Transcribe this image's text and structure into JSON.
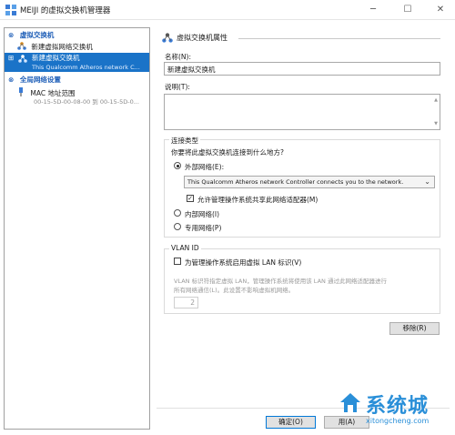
{
  "window": {
    "title": "MEIJI 的虚拟交换机管理器",
    "minimize": "─",
    "maximize": "☐",
    "close": "✕"
  },
  "tree": {
    "section1": {
      "toggle": "⊗",
      "label": "虚拟交换机"
    },
    "item_new_network_switch": "新建虚拟网络交换机",
    "item_selected": {
      "toggle": "⊞",
      "label": "新建虚拟交换机",
      "sublabel": "This Qualcomm Atheros network C..."
    },
    "section2": {
      "toggle": "⊗",
      "label": "全局网络设置"
    },
    "mac": {
      "label": "MAC 地址范围",
      "sublabel": "00-15-5D-00-08-00 到 00-15-5D-0..."
    }
  },
  "props": {
    "header": "虚拟交换机属性",
    "name_label": "名称(N):",
    "name_value": "新建虚拟交换机",
    "notes_label": "说明(T):",
    "conn_type_title": "连接类型",
    "conn_question": "你要将此虚拟交换机连接到什么地方?",
    "external_label": "外部网络(E):",
    "adapter_value": "This Qualcomm Atheros network Controller connects you to the network.",
    "allow_mgmt_label": "允许管理操作系统共享此网络适配器(M)",
    "internal_label": "内部网络(I)",
    "private_label": "专用网络(P)",
    "vlan_title": "VLAN ID",
    "vlan_enable_label": "为管理操作系统启用虚拟 LAN 标识(V)",
    "vlan_desc_line1": "VLAN 标识符指定虚拟 LAN，管理操作系统将使用该 LAN 通过此网络适配器进行",
    "vlan_desc_line2": "所有网络通信(L)。此设置不影响虚拟机网络。",
    "vlan_value": "2",
    "remove_button": "移除(R)"
  },
  "footer": {
    "ok_button": "确定(O)",
    "apply_button": "用(A)"
  },
  "watermark": {
    "text": "系统城",
    "url": "xitongcheng.com"
  }
}
